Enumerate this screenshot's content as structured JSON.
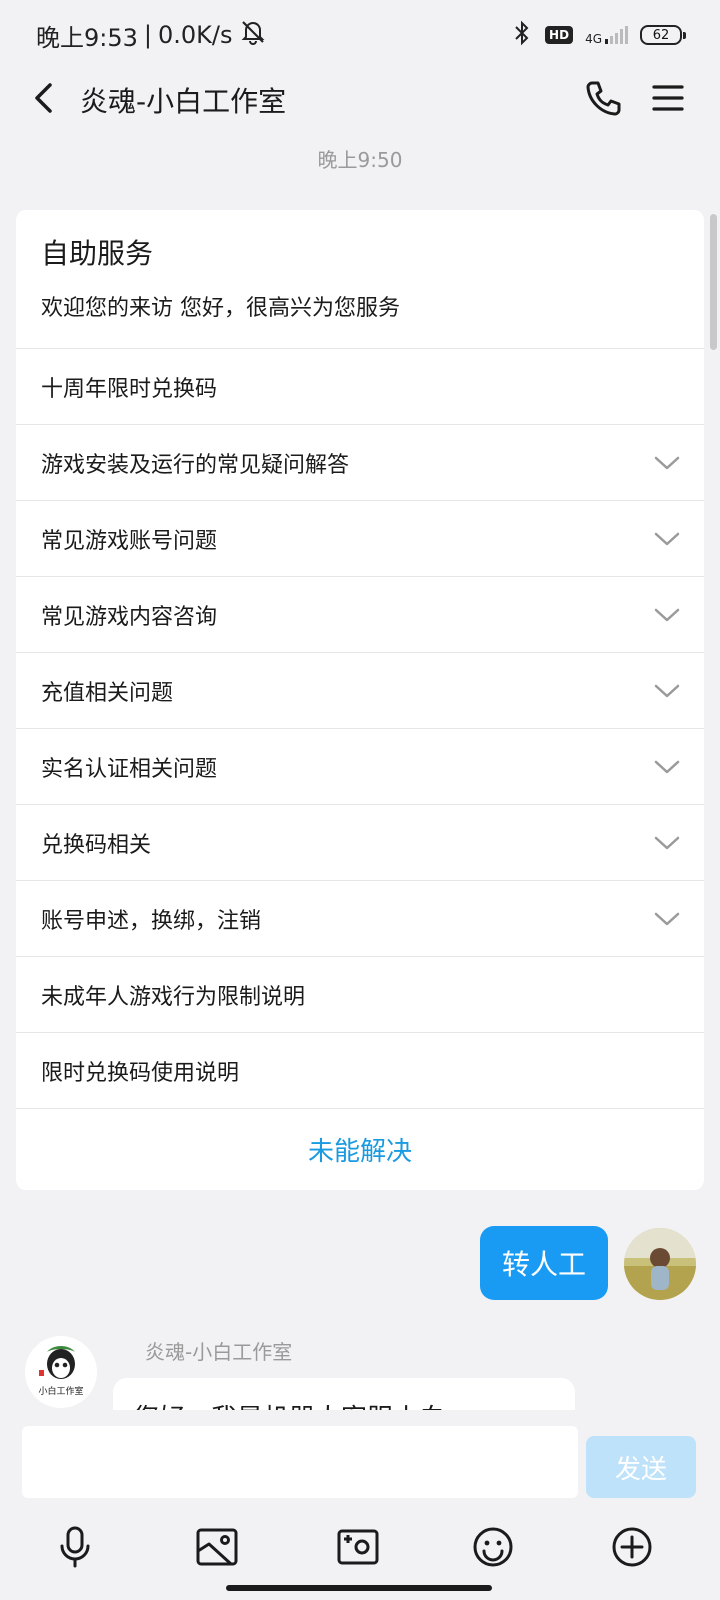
{
  "status_bar": {
    "time": "晚上9:53",
    "network_speed": "0.0K/s",
    "network_type": "4G",
    "hd_label": "HD",
    "battery": "62"
  },
  "header": {
    "title": "炎魂-小白工作室"
  },
  "timestamp": "晚上9:50",
  "service_card": {
    "title": "自助服务",
    "subtitle": "欢迎您的来访 您好，很高兴为您服务",
    "items": [
      {
        "label": "十周年限时兑换码",
        "expandable": false
      },
      {
        "label": "游戏安装及运行的常见疑问解答",
        "expandable": true
      },
      {
        "label": "常见游戏账号问题",
        "expandable": true
      },
      {
        "label": "常见游戏内容咨询",
        "expandable": true
      },
      {
        "label": "充值相关问题",
        "expandable": true
      },
      {
        "label": "实名认证相关问题",
        "expandable": true
      },
      {
        "label": "兑换码相关",
        "expandable": true
      },
      {
        "label": "账号申述，换绑，注销",
        "expandable": true
      },
      {
        "label": "未成年人游戏行为限制说明",
        "expandable": false
      },
      {
        "label": "限时兑换码使用说明",
        "expandable": false
      }
    ],
    "unsolved_label": "未能解决"
  },
  "my_message": {
    "text": "转人工"
  },
  "bot_message": {
    "sender": "炎魂-小白工作室",
    "text": "您好，我是机器人客服小白",
    "avatar_caption": "小白工作室"
  },
  "input_bar": {
    "placeholder": "",
    "send_label": "发送"
  },
  "colors": {
    "accent": "#1a9bf3",
    "link": "#1a9ae0",
    "send_disabled": "#bfe2fb",
    "background": "#f2f2f4"
  }
}
